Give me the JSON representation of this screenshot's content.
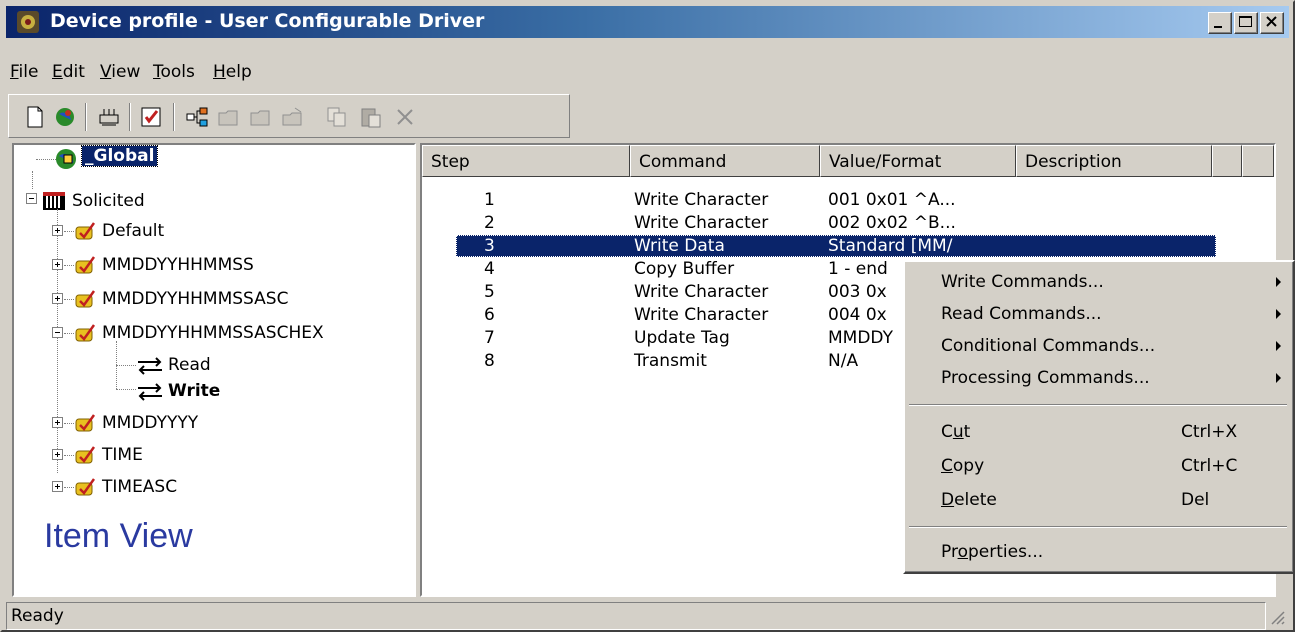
{
  "window": {
    "title": "Device profile - User Configurable Driver"
  },
  "menubar": [
    {
      "label": "File",
      "mnemonic": "F",
      "rest": "ile"
    },
    {
      "label": "Edit",
      "mnemonic": "E",
      "rest": "dit"
    },
    {
      "label": "View",
      "mnemonic": "V",
      "rest": "iew"
    },
    {
      "label": "Tools",
      "mnemonic": "T",
      "rest": "ools"
    },
    {
      "label": "Help",
      "mnemonic": "H",
      "rest": "elp"
    }
  ],
  "toolbar": {
    "icons": [
      "new-icon",
      "globe-icon",
      "device-icon",
      "checklist-icon",
      "tree-icon",
      "folder-icon",
      "folder-icon-2",
      "folder-icon-3",
      "copy-icon",
      "paste-icon",
      "delete-icon"
    ]
  },
  "tree": {
    "global_label": "_Global",
    "solicited_label": "Solicited",
    "items": [
      "Default",
      "MMDDYYHHMMSS",
      "MMDDYYHHMMSSASC",
      "MMDDYYHHMMSSASCHEX"
    ],
    "transactions": [
      "Read",
      "Write"
    ],
    "items_after": [
      "MMDDYYYY",
      "TIME",
      "TIMEASC"
    ],
    "view_label": "Item View"
  },
  "list": {
    "columns": [
      "Step",
      "Command",
      "Value/Format",
      "Description"
    ],
    "rows": [
      {
        "step": "1",
        "command": "Write Character",
        "value": "001  0x01  ^A...",
        "description": ""
      },
      {
        "step": "2",
        "command": "Write Character",
        "value": "002  0x02  ^B...",
        "description": ""
      },
      {
        "step": "3",
        "command": "Write Data",
        "value": "Standard [MM/",
        "description": ""
      },
      {
        "step": "4",
        "command": "Copy Buffer",
        "value": "1 - end",
        "description": ""
      },
      {
        "step": "5",
        "command": "Write Character",
        "value": "003  0x",
        "description": ""
      },
      {
        "step": "6",
        "command": "Write Character",
        "value": "004  0x",
        "description": ""
      },
      {
        "step": "7",
        "command": "Update Tag",
        "value": "MMDDY",
        "description": ""
      },
      {
        "step": "8",
        "command": "Transmit",
        "value": "N/A",
        "description": ""
      }
    ],
    "selected_step": "3"
  },
  "context_menu": {
    "submenus": [
      "Write Commands...",
      "Read Commands...",
      "Conditional Commands...",
      "Processing Commands..."
    ],
    "edit_items": [
      {
        "pre": "C",
        "mn": "u",
        "post": "t",
        "shortcut": "Ctrl+X"
      },
      {
        "pre": "",
        "mn": "C",
        "post": "opy",
        "shortcut": "Ctrl+C"
      },
      {
        "pre": "",
        "mn": "D",
        "post": "elete",
        "shortcut": "Del"
      }
    ],
    "properties": {
      "pre": "Pr",
      "mn": "o",
      "post": "perties..."
    }
  },
  "status": {
    "text": "Ready"
  },
  "colors": {
    "title_gradient_start": "#0a246a",
    "title_gradient_end": "#a6caf0",
    "selection": "#0a246a",
    "item_view_text": "#2a3aa0"
  }
}
